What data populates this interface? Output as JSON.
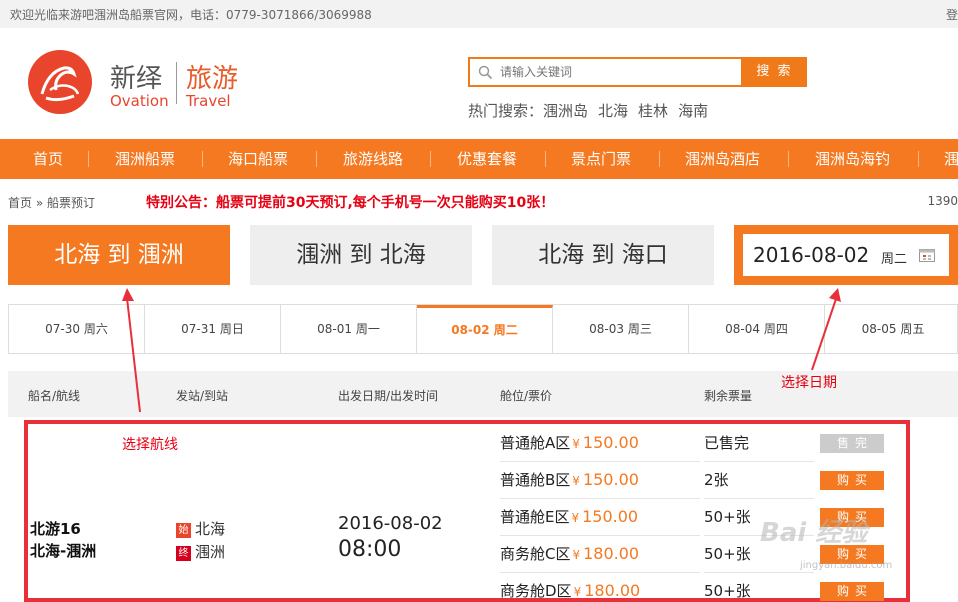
{
  "topbar": {
    "welcome": "欢迎光临来游吧涠洲岛船票官网，电话：0779-3071866/3069988",
    "login": "登"
  },
  "brand": {
    "name_cn_1": "新绎",
    "name_cn_2": "旅游",
    "name_en_1": "Ovation",
    "name_en_2": "Travel"
  },
  "search": {
    "placeholder": "请输入关键词",
    "button": "搜 索",
    "hot_label": "热门搜索：",
    "hot_items": [
      "涠洲岛",
      "北海",
      "桂林",
      "海南"
    ]
  },
  "nav": [
    "首页",
    "涠洲船票",
    "海口船票",
    "旅游线路",
    "优惠套餐",
    "景点门票",
    "涠洲岛酒店",
    "涠洲岛海钓",
    "涠"
  ],
  "breadcrumb": {
    "home": "首页",
    "sep": "»",
    "current": "船票预订"
  },
  "notice": "特别公告：船票可提前30天预订,每个手机号一次只能购买10张！",
  "phone": "1390",
  "routes": [
    "北海 到 涠洲",
    "涠洲 到 北海",
    "北海 到 海口"
  ],
  "date_picker": {
    "date": "2016-08-02",
    "weekday": "周二"
  },
  "date_tabs": [
    "07-30 周六",
    "07-31 周日",
    "08-01 周一",
    "08-02 周二",
    "08-03 周三",
    "08-04 周四",
    "08-05 周五"
  ],
  "table_header": {
    "ship": "船名/航线",
    "station": "发站/到站",
    "time": "出发日期/出发时间",
    "cabin": "舱位/票价",
    "remain": "剩余票量"
  },
  "annotations": {
    "select_route": "选择航线",
    "select_date": "选择日期"
  },
  "voyage": {
    "ship": "北游16",
    "route": "北海-涠洲",
    "from_tag": "始",
    "from": "北海",
    "to_tag": "终",
    "to": "涠洲",
    "date": "2016-08-02",
    "time": "08:00",
    "currency": "¥",
    "cabins": [
      {
        "name": "普通舱A区",
        "price": "150.00",
        "remain": "已售完",
        "action": "售完"
      },
      {
        "name": "普通舱B区",
        "price": "150.00",
        "remain": "2张",
        "action": "购买"
      },
      {
        "name": "普通舱E区",
        "price": "150.00",
        "remain": "50+张",
        "action": "购买"
      },
      {
        "name": "商务舱C区",
        "price": "180.00",
        "remain": "50+张",
        "action": "购买"
      },
      {
        "name": "商务舱D区",
        "price": "180.00",
        "remain": "50+张",
        "action": "购买"
      }
    ]
  },
  "watermark": {
    "main": "Bai 经验",
    "sub": "jingyan.baidu.com"
  },
  "colors": {
    "accent": "#f47920",
    "alert": "#e60012"
  }
}
